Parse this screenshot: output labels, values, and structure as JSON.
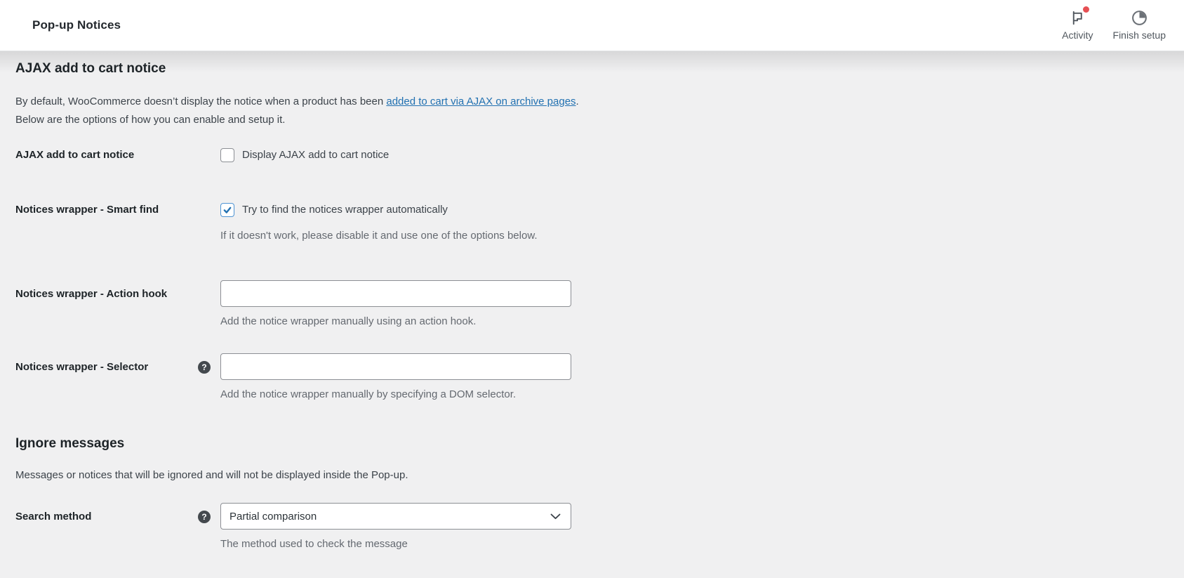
{
  "header": {
    "title": "Pop-up Notices",
    "activity": {
      "label": "Activity"
    },
    "finish_setup": {
      "label": "Finish setup"
    }
  },
  "icons": {
    "help_glyph": "?",
    "activity_icon": "flag-with-red-dot",
    "finish_setup_icon": "progress-pie-circle"
  },
  "colors": {
    "accent_blue": "#2271b1",
    "link_blue": "#2271b1",
    "checked_border_blue": "#4f94d4",
    "badge_red": "#e65054",
    "content_bg": "#f0f0f1",
    "header_bg": "#ffffff",
    "heading_text": "#1d2327",
    "body_text": "#3c434a",
    "muted_text": "#646970",
    "input_border": "#8c8f94"
  },
  "ajax_section": {
    "heading": "AJAX add to cart notice",
    "intro": {
      "before_link": "By default, WooCommerce doesn’t display the notice when a product has been ",
      "link": "added to cart via AJAX on archive pages",
      "after_link": ".",
      "line2": "Below are the options of how you can enable and setup it."
    },
    "rows": {
      "ajax_notice": {
        "label": "AJAX add to cart notice",
        "checkbox_label": "Display AJAX add to cart notice",
        "checked": false
      },
      "smart_find": {
        "label": "Notices wrapper - Smart find",
        "checkbox_label": "Try to find the notices wrapper automatically",
        "checked": true,
        "help": "If it doesn't work, please disable it and use one of the options below."
      },
      "action_hook": {
        "label": "Notices wrapper - Action hook",
        "input_value": "",
        "help": "Add the notice wrapper manually using an action hook."
      },
      "selector": {
        "label": "Notices wrapper - Selector",
        "input_value": "",
        "help": "Add the notice wrapper manually by specifying a DOM selector."
      }
    }
  },
  "ignore_section": {
    "heading": "Ignore messages",
    "description": "Messages or notices that will be ignored and will not be displayed inside the Pop-up.",
    "rows": {
      "search_method": {
        "label": "Search method",
        "select_value": "Partial comparison",
        "help": "The method used to check the message"
      }
    }
  }
}
